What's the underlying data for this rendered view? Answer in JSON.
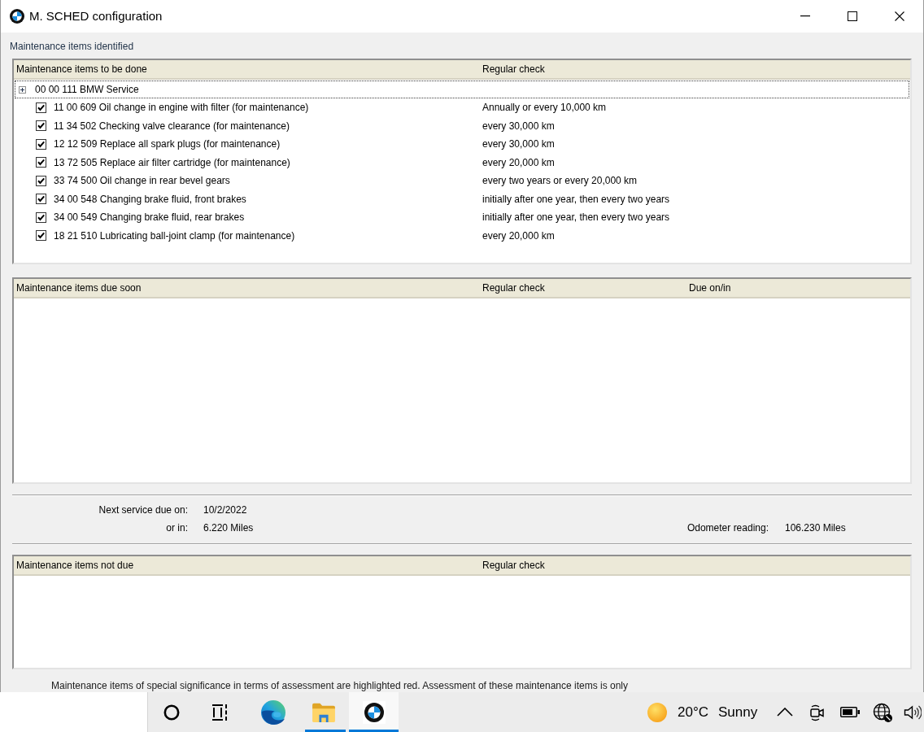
{
  "window": {
    "title": "M. SCHED configuration"
  },
  "identified": {
    "label": "Maintenance items identified",
    "columns": [
      "Maintenance items to be done",
      "Regular check"
    ],
    "tree": [
      {
        "label": "00 00 111 BMW Service",
        "expanded": false,
        "selected": true,
        "children": [
          {
            "label": "11 00 609 Oil change in engine with filter (for maintenance)",
            "regular_check": "Annually or every 10,000 km",
            "checked": true,
            "selected": false
          },
          {
            "label": "11 34 502 Checking valve clearance (for maintenance)",
            "regular_check": "every 30,000 km",
            "checked": true,
            "selected": false
          },
          {
            "label": "12 12 509 Replace all spark plugs (for maintenance)",
            "regular_check": "every 30,000 km",
            "checked": true,
            "selected": false
          },
          {
            "label": "13 72 505 Replace air filter cartridge (for maintenance)",
            "regular_check": "every 20,000 km",
            "checked": true,
            "selected": false
          },
          {
            "label": "33 74 500 Oil change in rear bevel gears",
            "regular_check": "every two years or every 20,000 km",
            "checked": true,
            "selected": false
          },
          {
            "label": "34 00 548 Changing brake fluid, front brakes",
            "regular_check": "initially after one year, then every two years",
            "checked": true,
            "selected": false
          },
          {
            "label": "34 00 549 Changing brake fluid, rear brakes",
            "regular_check": "initially after one year, then every two years",
            "checked": true,
            "selected": false
          },
          {
            "label": "18 21 510 Lubricating ball-joint clamp (for maintenance)",
            "regular_check": "every 20,000 km",
            "checked": true,
            "selected": false
          }
        ]
      }
    ]
  },
  "due_soon": {
    "columns": [
      "Maintenance items due soon",
      "Regular check",
      "Due on/in"
    ]
  },
  "next_service": {
    "rows": [
      {
        "label": "Next service due on:",
        "value": "10/2/2022"
      },
      {
        "label": "or in:",
        "value": "6.220 Miles"
      }
    ],
    "odometer": {
      "label": "Odometer reading:",
      "value": "106.230 Miles"
    }
  },
  "not_due": {
    "columns": [
      "Maintenance items not due",
      "Regular check"
    ]
  },
  "footnote": "Maintenance items of special significance in terms of assessment are highlighted red. Assessment of these maintenance items is only",
  "taskbar": {
    "apps": [
      {
        "kind": "assistant",
        "running": false,
        "selected": false
      },
      {
        "kind": "task_view",
        "running": false,
        "selected": false
      },
      {
        "kind": "browser",
        "running": false,
        "selected": false
      },
      {
        "kind": "files",
        "running": true,
        "selected": false
      },
      {
        "kind": "app",
        "running": true,
        "selected": true
      }
    ],
    "weather": {
      "temperature": "20°C",
      "condition": "Sunny"
    },
    "tray": [
      {
        "kind": "chevron"
      },
      {
        "kind": "camera"
      },
      {
        "kind": "battery"
      },
      {
        "kind": "network"
      },
      {
        "kind": "volume"
      }
    ]
  }
}
